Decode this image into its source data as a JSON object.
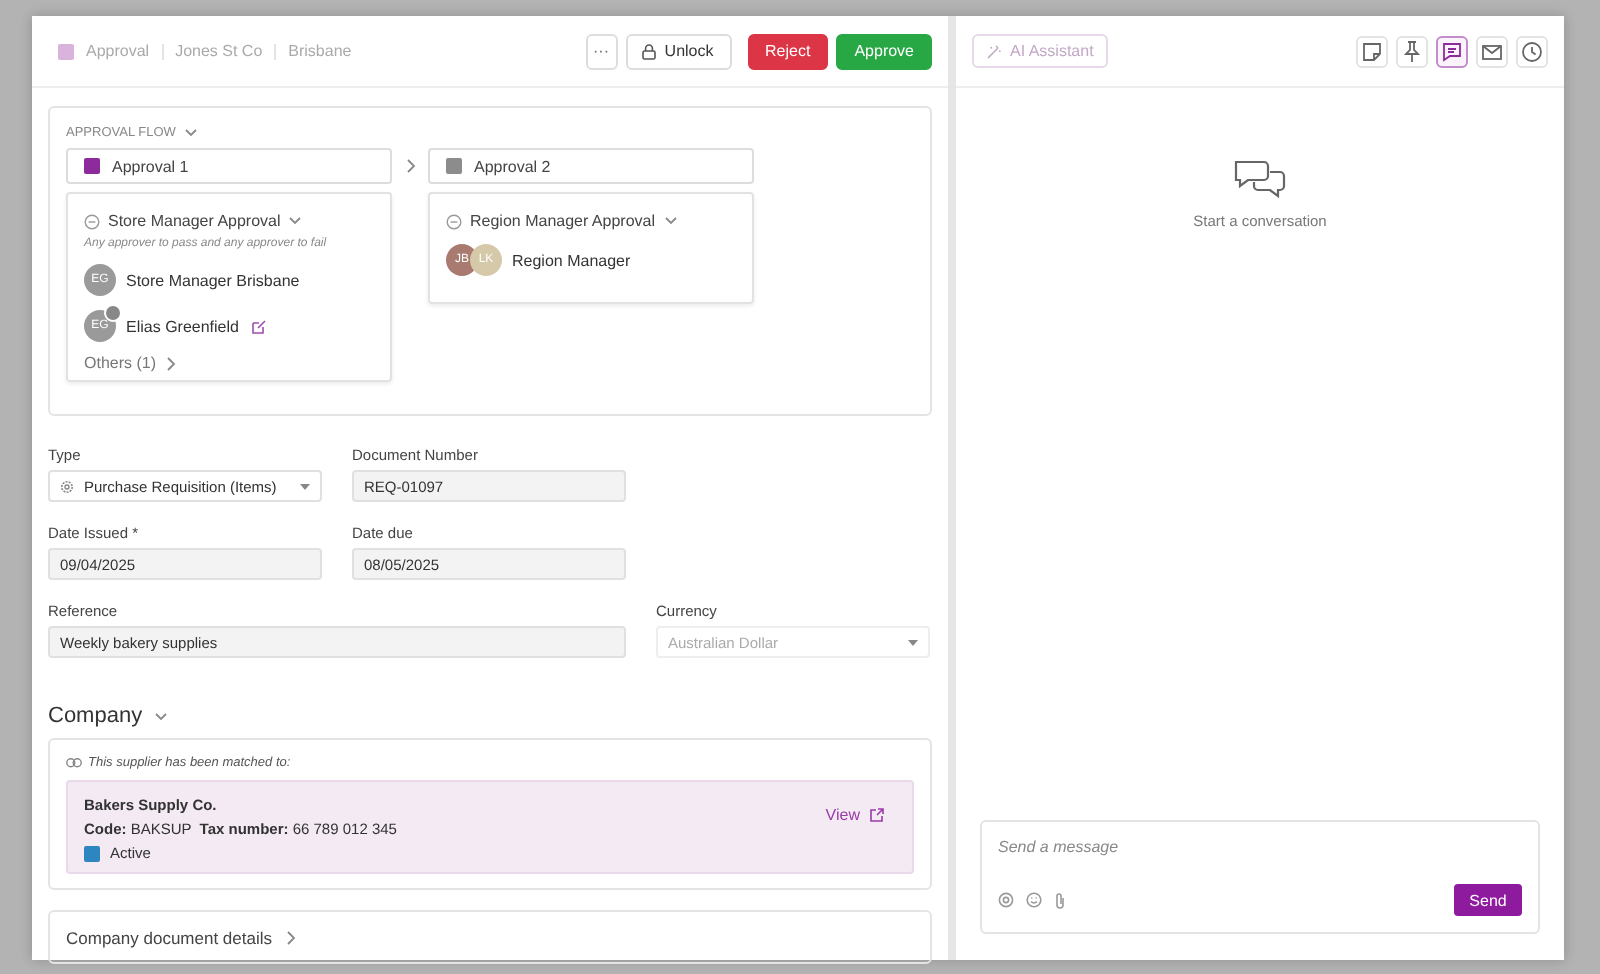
{
  "breadcrumb": [
    "Approval",
    "Jones St Co",
    "Brisbane"
  ],
  "actions": [
    {
      "label": "···",
      "kind": "more"
    },
    {
      "label": "Unlock",
      "kind": "unlock"
    },
    {
      "label": "Reject",
      "kind": "danger"
    },
    {
      "label": "Approve",
      "kind": "primary"
    }
  ],
  "approval_flow": {
    "title": "APPROVAL FLOW",
    "stages": [
      {
        "name": "Approval 1",
        "color": "#8e2b9c",
        "step": {
          "title": "Store Manager Approval",
          "rule": "Any approver to pass and any approver to fail",
          "approvers": [
            {
              "name": "Store Manager Brisbane",
              "badge": false,
              "editable": false,
              "avatars": [
                {
                  "initials": "EG",
                  "color": "#9a9a9a"
                }
              ]
            },
            {
              "name": "Elias Greenfield",
              "badge": true,
              "editable": true,
              "avatars": [
                {
                  "initials": "EG",
                  "color": "#9a9a9a"
                }
              ]
            }
          ],
          "others": "Others (1)"
        }
      },
      {
        "name": "Approval 2",
        "color": "#8c8c8c",
        "step": {
          "title": "Region Manager Approval",
          "approvers": [
            {
              "name": "Region Manager",
              "badge": false,
              "editable": false,
              "avatars": [
                {
                  "initials": "JB",
                  "color": "#a87a70"
                },
                {
                  "initials": "LK",
                  "color": "#d6c9a9"
                }
              ]
            }
          ]
        }
      }
    ]
  },
  "fields": [
    [
      {
        "label": "Type",
        "value": "Purchase Requisition (Items)",
        "kind": "select",
        "disabled": false
      },
      {
        "label": "Document Number",
        "value": "REQ-01097",
        "kind": "text",
        "disabled": false
      }
    ],
    [
      {
        "label": "Date Issued *",
        "value": "09/04/2025",
        "kind": "text",
        "disabled": false
      },
      {
        "label": "Date due",
        "value": "08/05/2025",
        "kind": "text",
        "disabled": false
      }
    ],
    [
      {
        "label": "Reference",
        "value": "Weekly bakery supplies",
        "kind": "text",
        "disabled": false
      },
      {
        "label": "Currency",
        "value": "Australian Dollar",
        "kind": "select",
        "disabled": true
      }
    ]
  ],
  "company": {
    "title": "Company",
    "note": "This supplier has been matched to:",
    "supplier": {
      "name": "Bakers Supply Co.",
      "details": "**Code:** BAKSUP  **Tax number:** 66 789 012 345",
      "status": {
        "label": "Active",
        "color": "#2e86c1"
      },
      "link": "View"
    }
  },
  "document_details": {
    "title": "Company document details",
    "expanded": false
  },
  "chat": {
    "ai_button": "AI Assistant",
    "tools": [
      {
        "kind": "note",
        "selected": false
      },
      {
        "kind": "pin",
        "selected": false
      },
      {
        "kind": "chat",
        "selected": true
      },
      {
        "kind": "mail",
        "selected": false
      },
      {
        "kind": "clock",
        "selected": false
      }
    ],
    "empty_text": "Start a conversation",
    "composer": {
      "placeholder": "Send a message",
      "send": "Send"
    }
  }
}
